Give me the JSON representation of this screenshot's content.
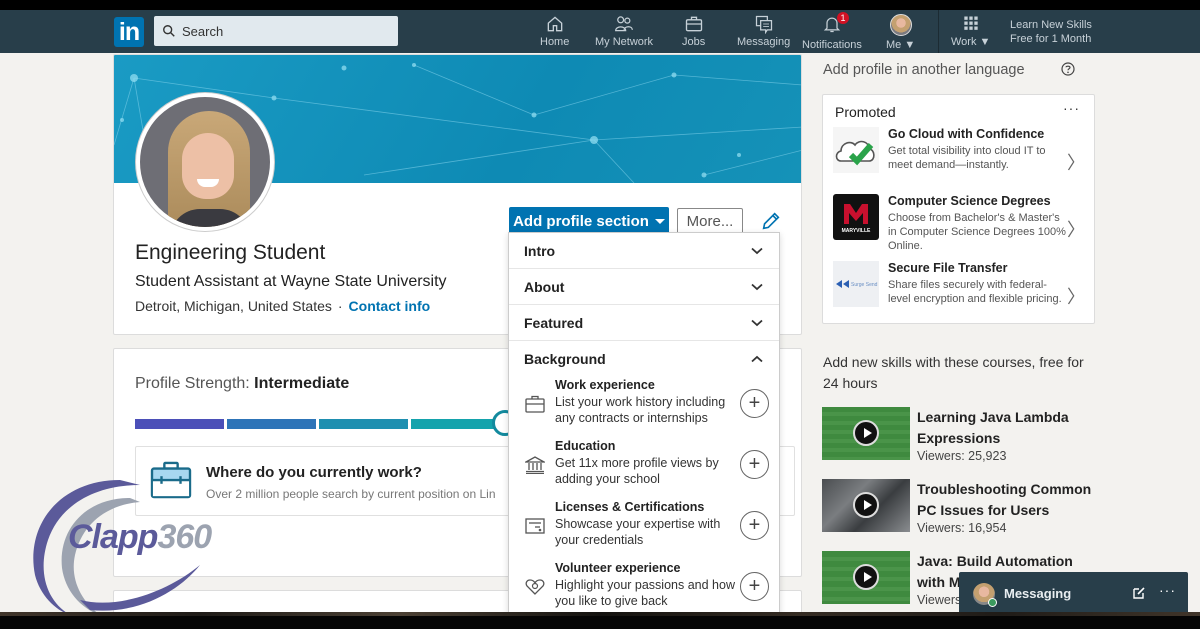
{
  "nav": {
    "logo": "in",
    "search_placeholder": "Search",
    "items": [
      {
        "label": "Home",
        "icon": "home-icon"
      },
      {
        "label": "My Network",
        "icon": "network-icon"
      },
      {
        "label": "Jobs",
        "icon": "briefcase-icon"
      },
      {
        "label": "Messaging",
        "icon": "messaging-icon"
      },
      {
        "label": "Notifications",
        "icon": "bell-icon",
        "badge": "1"
      },
      {
        "label": "Me",
        "icon": "avatar"
      },
      {
        "label": "Work",
        "icon": "grid-icon"
      }
    ],
    "learn_line1": "Learn New Skills",
    "learn_line2": "Free for 1 Month"
  },
  "profile": {
    "name": "Engineering Student",
    "headline": "Student Assistant at Wayne State University",
    "location": "Detroit, Michigan, United States",
    "separator": "·",
    "contact_link": "Contact info",
    "add_section_button": "Add profile section",
    "more_button": "More..."
  },
  "dropdown": {
    "sections": [
      {
        "label": "Intro",
        "expanded": false
      },
      {
        "label": "About",
        "expanded": false
      },
      {
        "label": "Featured",
        "expanded": false
      },
      {
        "label": "Background",
        "expanded": true
      }
    ],
    "background_items": [
      {
        "title": "Work experience",
        "desc": "List your work history including any contracts or internships",
        "icon": "briefcase-icon"
      },
      {
        "title": "Education",
        "desc": "Get 11x more profile views by adding your school",
        "icon": "school-icon"
      },
      {
        "title": "Licenses & Certifications",
        "desc": "Showcase your expertise with your credentials",
        "icon": "certificate-icon"
      },
      {
        "title": "Volunteer experience",
        "desc": "Highlight your passions and how you like to give back",
        "icon": "heart-icon"
      }
    ]
  },
  "strength": {
    "label": "Profile Strength: ",
    "level": "Intermediate",
    "segments_filled": 4,
    "colors": [
      "#4b4fb8",
      "#2d74b8",
      "#1e8fb0",
      "#14a3ac"
    ],
    "prompt_title": "Where do you currently work?",
    "prompt_sub": "Over 2 million people search by current position on Lin"
  },
  "rail": {
    "language_link": "Add profile in another language",
    "promoted_label": "Promoted",
    "more": "···",
    "ads": [
      {
        "title": "Go Cloud with Confidence",
        "desc": "Get total visibility into cloud IT to meet demand—instantly."
      },
      {
        "title": "Computer Science Degrees",
        "desc": "Choose from Bachelor's & Master's in Computer Science Degrees 100% Online.",
        "logo_text": "MARYVILLE"
      },
      {
        "title": "Secure File Transfer",
        "desc": "Share files securely with federal-level encryption and flexible pricing.",
        "logo_text": "Surge Send"
      }
    ],
    "courses_header": "Add new skills with these courses, free for 24 hours",
    "courses": [
      {
        "title": "Learning Java Lambda Expressions",
        "viewers": "Viewers: 25,923"
      },
      {
        "title": "Troubleshooting Common PC Issues for Users",
        "viewers": "Viewers: 16,954"
      },
      {
        "title": "Java: Build Automation with M",
        "viewers": "Viewers"
      }
    ]
  },
  "messaging": {
    "label": "Messaging",
    "more": "···"
  },
  "watermark": {
    "part1": "Clapp",
    "part2": "360"
  },
  "colors": {
    "nav_bg": "#283e4a",
    "brand_blue": "#0073b1",
    "badge_red": "#d11124"
  }
}
